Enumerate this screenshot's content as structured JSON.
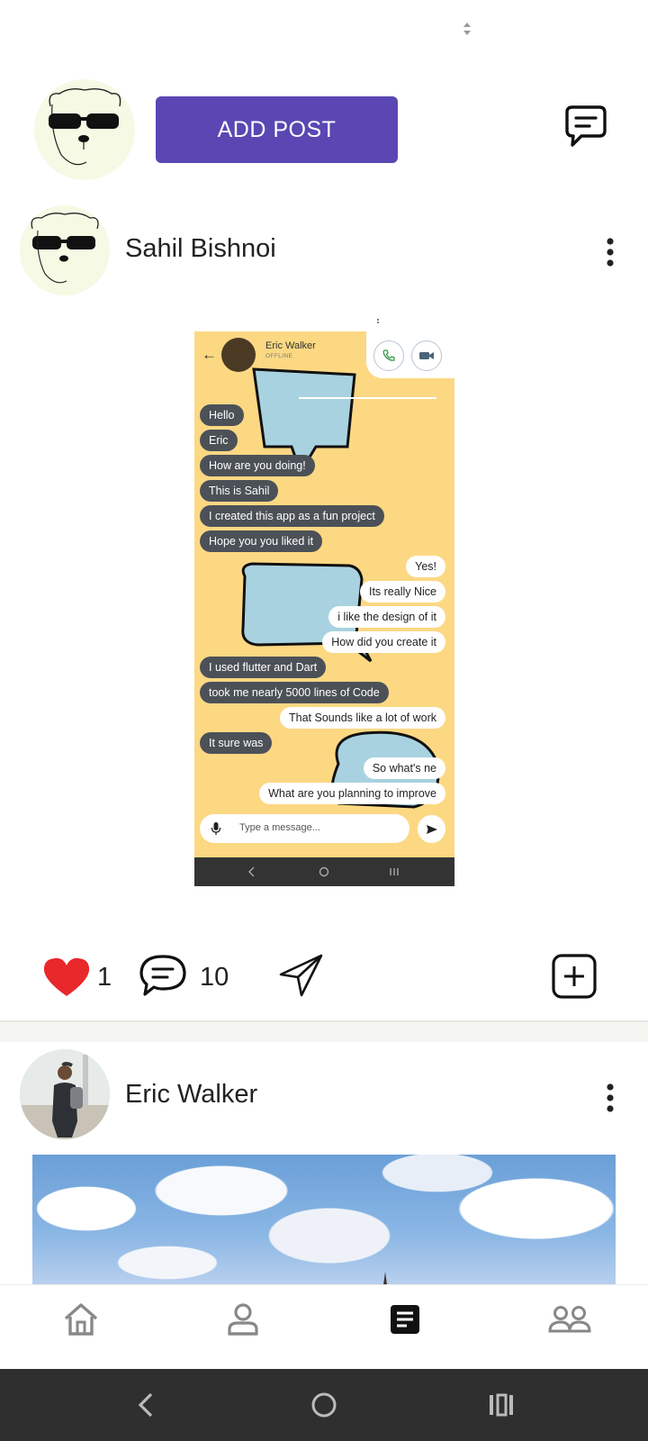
{
  "header": {
    "add_post_label": "ADD POST"
  },
  "posts": [
    {
      "author": "Sahil Bishnoi",
      "image": {
        "chat_name": "Eric Walker",
        "chat_status": "OFFLINE",
        "messages": [
          {
            "text": "Hello",
            "side": "in"
          },
          {
            "text": "Eric",
            "side": "in"
          },
          {
            "text": "How are you doing!",
            "side": "in"
          },
          {
            "text": "This is Sahil",
            "side": "in"
          },
          {
            "text": "I created this app as a fun project",
            "side": "in"
          },
          {
            "text": "Hope you you liked it",
            "side": "in"
          },
          {
            "text": "Yes!",
            "side": "out"
          },
          {
            "text": "Its really Nice",
            "side": "out"
          },
          {
            "text": "i like the design of it",
            "side": "out"
          },
          {
            "text": "How did you create it",
            "side": "out"
          },
          {
            "text": "I used flutter and Dart",
            "side": "in"
          },
          {
            "text": "took me nearly 5000 lines of Code",
            "side": "in"
          },
          {
            "text": "That Sounds like a lot of work",
            "side": "out"
          },
          {
            "text": "It sure was",
            "side": "in"
          },
          {
            "text": "So what's ne",
            "side": "out"
          },
          {
            "text": "What are you planning to improve",
            "side": "out"
          }
        ],
        "compose_placeholder": "Type a message..."
      },
      "likes": "1",
      "comments": "10"
    },
    {
      "author": "Eric Walker"
    }
  ],
  "colors": {
    "accent": "#5a47b3",
    "like": "#e8282b",
    "chat_bg": "#fcd883"
  },
  "icons": {
    "messages": "chat-bubble-icon",
    "like": "heart-icon",
    "comment": "comment-icon",
    "share": "send-icon",
    "save": "add-square-icon",
    "nav": [
      "home-icon",
      "person-icon",
      "document-icon",
      "people-icon"
    ]
  }
}
